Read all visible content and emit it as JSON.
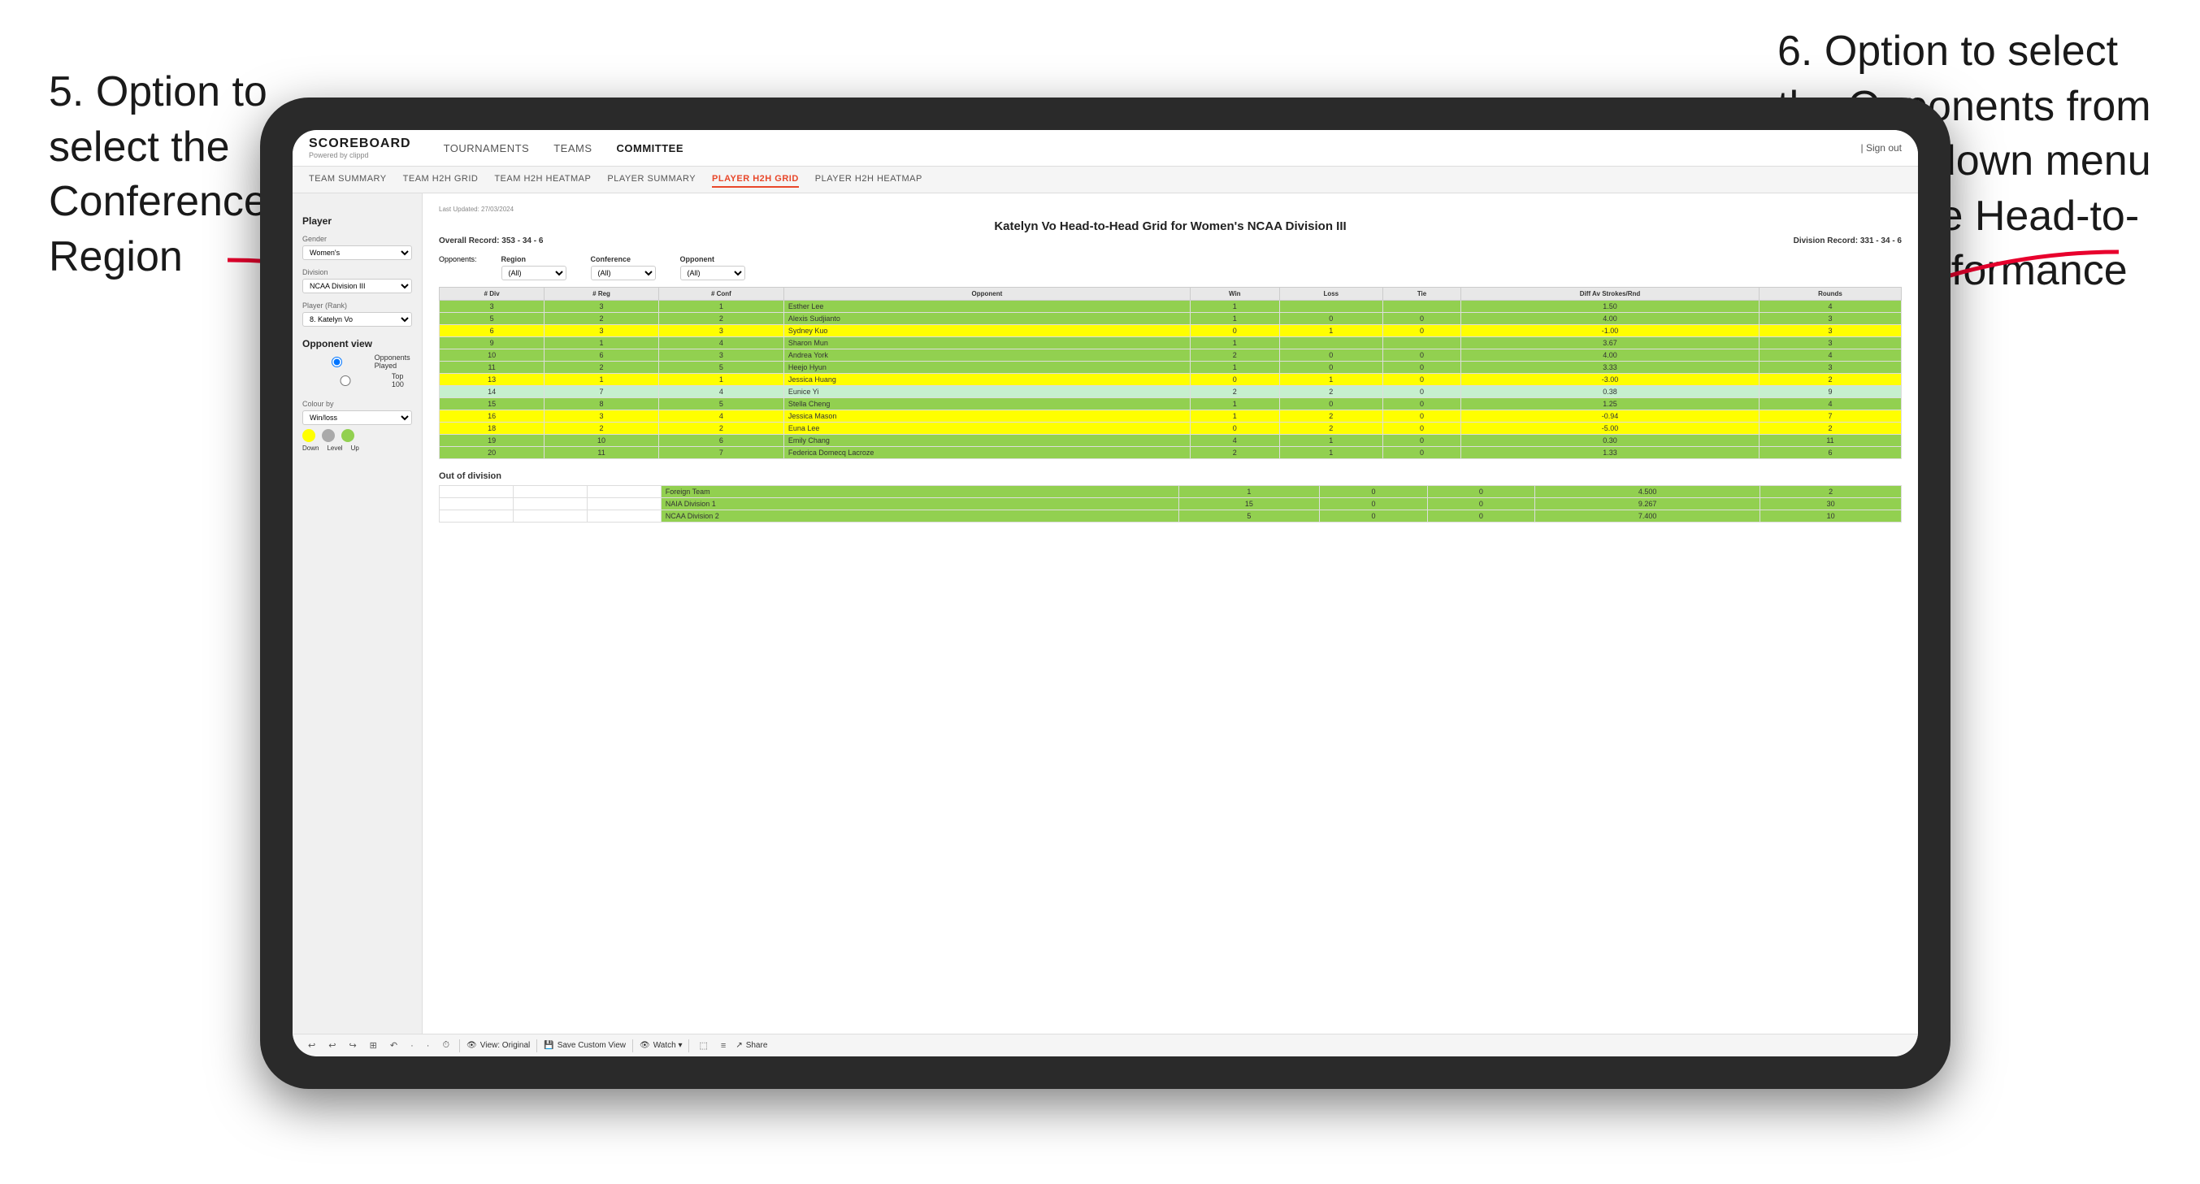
{
  "annotations": {
    "left": "5. Option to select the Conference and Region",
    "right": "6. Option to select the Opponents from the dropdown menu to see the Head-to-Head performance"
  },
  "nav": {
    "logo": "SCOREBOARD",
    "logo_sub": "Powered by clippd",
    "items": [
      "TOURNAMENTS",
      "TEAMS",
      "COMMITTEE"
    ],
    "sign_out": "| Sign out"
  },
  "sub_nav": {
    "items": [
      "TEAM SUMMARY",
      "TEAM H2H GRID",
      "TEAM H2H HEATMAP",
      "PLAYER SUMMARY",
      "PLAYER H2H GRID",
      "PLAYER H2H HEATMAP"
    ]
  },
  "sidebar": {
    "player_label": "Player",
    "gender_label": "Gender",
    "gender_value": "Women's",
    "division_label": "Division",
    "division_value": "NCAA Division III",
    "player_rank_label": "Player (Rank)",
    "player_rank_value": "8. Katelyn Vo",
    "opponent_view_label": "Opponent view",
    "opponent_view_options": [
      "Opponents Played",
      "Top 100"
    ],
    "colour_by_label": "Colour by",
    "colour_by_value": "Win/loss",
    "circles_labels": [
      "Down",
      "Level",
      "Up"
    ]
  },
  "content": {
    "last_updated": "Last Updated: 27/03/2024",
    "title": "Katelyn Vo Head-to-Head Grid for Women's NCAA Division III",
    "overall_record_label": "Overall Record:",
    "overall_record": "353 - 34 - 6",
    "division_record_label": "Division Record:",
    "division_record": "331 - 34 - 6",
    "filters": {
      "opponents_label": "Opponents:",
      "region_label": "Region",
      "region_value": "(All)",
      "conference_label": "Conference",
      "conference_value": "(All)",
      "opponent_label": "Opponent",
      "opponent_value": "(All)"
    },
    "table_headers": [
      "# Div",
      "# Reg",
      "# Conf",
      "Opponent",
      "Win",
      "Loss",
      "Tie",
      "Diff Av Strokes/Rnd",
      "Rounds"
    ],
    "rows": [
      {
        "div": "3",
        "reg": "3",
        "conf": "1",
        "opponent": "Esther Lee",
        "win": "1",
        "loss": "",
        "tie": "",
        "diff": "1.50",
        "rounds": "4",
        "color": "green"
      },
      {
        "div": "5",
        "reg": "2",
        "conf": "2",
        "opponent": "Alexis Sudjianto",
        "win": "1",
        "loss": "0",
        "tie": "0",
        "diff": "4.00",
        "rounds": "3",
        "color": "green"
      },
      {
        "div": "6",
        "reg": "3",
        "conf": "3",
        "opponent": "Sydney Kuo",
        "win": "0",
        "loss": "1",
        "tie": "0",
        "diff": "-1.00",
        "rounds": "3",
        "color": "yellow"
      },
      {
        "div": "9",
        "reg": "1",
        "conf": "4",
        "opponent": "Sharon Mun",
        "win": "1",
        "loss": "",
        "tie": "",
        "diff": "3.67",
        "rounds": "3",
        "color": "green"
      },
      {
        "div": "10",
        "reg": "6",
        "conf": "3",
        "opponent": "Andrea York",
        "win": "2",
        "loss": "0",
        "tie": "0",
        "diff": "4.00",
        "rounds": "4",
        "color": "green"
      },
      {
        "div": "11",
        "reg": "2",
        "conf": "5",
        "opponent": "Heejo Hyun",
        "win": "1",
        "loss": "0",
        "tie": "0",
        "diff": "3.33",
        "rounds": "3",
        "color": "green"
      },
      {
        "div": "13",
        "reg": "1",
        "conf": "1",
        "opponent": "Jessica Huang",
        "win": "0",
        "loss": "1",
        "tie": "0",
        "diff": "-3.00",
        "rounds": "2",
        "color": "yellow"
      },
      {
        "div": "14",
        "reg": "7",
        "conf": "4",
        "opponent": "Eunice Yi",
        "win": "2",
        "loss": "2",
        "tie": "0",
        "diff": "0.38",
        "rounds": "9",
        "color": "light-green"
      },
      {
        "div": "15",
        "reg": "8",
        "conf": "5",
        "opponent": "Stella Cheng",
        "win": "1",
        "loss": "0",
        "tie": "0",
        "diff": "1.25",
        "rounds": "4",
        "color": "green"
      },
      {
        "div": "16",
        "reg": "3",
        "conf": "4",
        "opponent": "Jessica Mason",
        "win": "1",
        "loss": "2",
        "tie": "0",
        "diff": "-0.94",
        "rounds": "7",
        "color": "yellow"
      },
      {
        "div": "18",
        "reg": "2",
        "conf": "2",
        "opponent": "Euna Lee",
        "win": "0",
        "loss": "2",
        "tie": "0",
        "diff": "-5.00",
        "rounds": "2",
        "color": "yellow"
      },
      {
        "div": "19",
        "reg": "10",
        "conf": "6",
        "opponent": "Emily Chang",
        "win": "4",
        "loss": "1",
        "tie": "0",
        "diff": "0.30",
        "rounds": "11",
        "color": "green"
      },
      {
        "div": "20",
        "reg": "11",
        "conf": "7",
        "opponent": "Federica Domecq Lacroze",
        "win": "2",
        "loss": "1",
        "tie": "0",
        "diff": "1.33",
        "rounds": "6",
        "color": "green"
      }
    ],
    "out_of_division_label": "Out of division",
    "out_of_division_rows": [
      {
        "opponent": "Foreign Team",
        "win": "1",
        "loss": "0",
        "tie": "0",
        "diff": "4.500",
        "rounds": "2",
        "color": "green"
      },
      {
        "opponent": "NAIA Division 1",
        "win": "15",
        "loss": "0",
        "tie": "0",
        "diff": "9.267",
        "rounds": "30",
        "color": "green"
      },
      {
        "opponent": "NCAA Division 2",
        "win": "5",
        "loss": "0",
        "tie": "0",
        "diff": "7.400",
        "rounds": "10",
        "color": "green"
      }
    ]
  },
  "toolbar": {
    "items": [
      "↩",
      "↩",
      "↪",
      "⊞",
      "↶",
      "·",
      "·",
      "⏱",
      "|",
      "View: Original",
      "|",
      "Save Custom View",
      "|",
      "👁 Watch ▾",
      "|",
      "⬚",
      "≡",
      "Share"
    ]
  }
}
